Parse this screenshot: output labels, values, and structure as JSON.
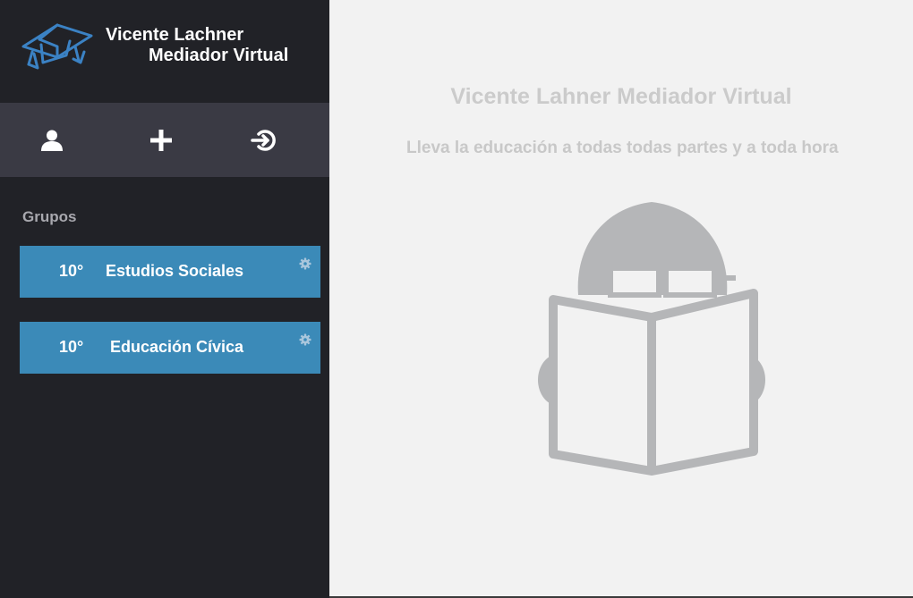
{
  "brand": {
    "line1": "Vicente Lachner",
    "line2": "Mediador Virtual",
    "logo_icon": "graduation-cap-icon",
    "logo_color": "#3b82c4"
  },
  "toolbar": {
    "icons": [
      "user-icon",
      "plus-icon",
      "logout-icon"
    ]
  },
  "sidebar": {
    "groups_label": "Grupos",
    "groups": [
      {
        "grade": "10°",
        "name": "Estudios Sociales"
      },
      {
        "grade": "10°",
        "name": "Educación Cívica"
      }
    ]
  },
  "main": {
    "title": "Vicente Lahner Mediador Virtual",
    "subtitle": "Lleva la educación a todas todas partes y a toda hora",
    "illustration": "student-reading-book-icon"
  },
  "colors": {
    "sidebar_bg": "#212227",
    "toolbar_bg": "#3a3a44",
    "group_bg": "#3b8ab8",
    "main_bg": "#f2f2f2",
    "illustration": "#b5b6b8"
  }
}
